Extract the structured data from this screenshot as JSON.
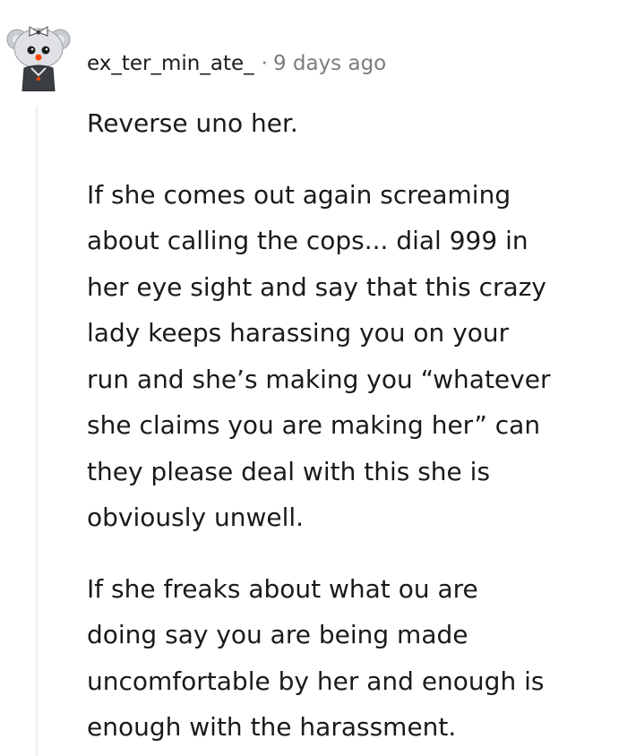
{
  "comment": {
    "author": "ex_ter_min_ate_",
    "separator": "·",
    "timestamp": "9 days ago",
    "avatar_icon": "snoo-avatar-icon",
    "paragraphs": [
      "Reverse uno her.",
      "If she comes out again screaming\nabout calling the cops... dial 999 in\nher eye sight and say that this crazy\nlady keeps harassing you on your\nrun and she’s making you “whatever\nshe claims you are making her” can\nthey please deal with this she is\nobviously unwell.",
      "If she freaks about what ou are\ndoing say you are being made\nuncomfortable by her and enough is\nenough with the harassment."
    ]
  },
  "colors": {
    "text": "#1a1a1b",
    "meta": "#7c7c7c",
    "thread_line": "#edeff1",
    "avatar_accent": "#ff4500"
  }
}
